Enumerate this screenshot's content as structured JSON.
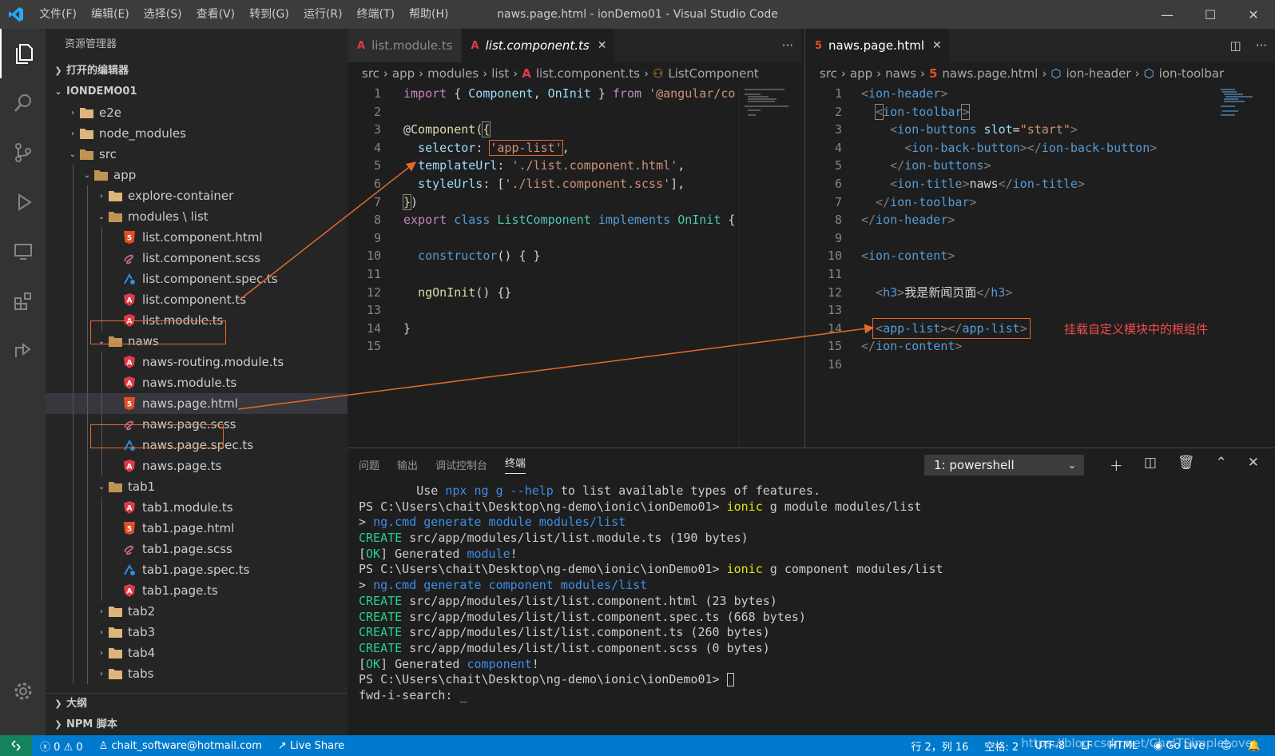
{
  "window": {
    "title": "naws.page.html - ionDemo01 - Visual Studio Code",
    "minimize": "—",
    "maximize": "☐",
    "close": "✕"
  },
  "menu": [
    "文件(F)",
    "编辑(E)",
    "选择(S)",
    "查看(V)",
    "转到(G)",
    "运行(R)",
    "终端(T)",
    "帮助(H)"
  ],
  "sidebar": {
    "title": "资源管理器",
    "open_editors": "打开的编辑器",
    "project": "IONDEMO01",
    "tree": [
      {
        "label": "e2e",
        "depth": 1,
        "type": "folder",
        "open": false
      },
      {
        "label": "node_modules",
        "depth": 1,
        "type": "folder",
        "open": false
      },
      {
        "label": "src",
        "depth": 1,
        "type": "folder",
        "open": true
      },
      {
        "label": "app",
        "depth": 2,
        "type": "folder",
        "open": true
      },
      {
        "label": "explore-container",
        "depth": 3,
        "type": "folder",
        "open": false
      },
      {
        "label": "modules \\ list",
        "depth": 3,
        "type": "folder",
        "open": true
      },
      {
        "label": "list.component.html",
        "depth": 4,
        "type": "html"
      },
      {
        "label": "list.component.scss",
        "depth": 4,
        "type": "scss"
      },
      {
        "label": "list.component.spec.ts",
        "depth": 4,
        "type": "spec"
      },
      {
        "label": "list.component.ts",
        "depth": 4,
        "type": "ts"
      },
      {
        "label": "list.module.ts",
        "depth": 4,
        "type": "ts"
      },
      {
        "label": "naws",
        "depth": 3,
        "type": "folder",
        "open": true
      },
      {
        "label": "naws-routing.module.ts",
        "depth": 4,
        "type": "ts"
      },
      {
        "label": "naws.module.ts",
        "depth": 4,
        "type": "ts"
      },
      {
        "label": "naws.page.html",
        "depth": 4,
        "type": "html",
        "selected": true
      },
      {
        "label": "naws.page.scss",
        "depth": 4,
        "type": "scss"
      },
      {
        "label": "naws.page.spec.ts",
        "depth": 4,
        "type": "spec"
      },
      {
        "label": "naws.page.ts",
        "depth": 4,
        "type": "ts"
      },
      {
        "label": "tab1",
        "depth": 3,
        "type": "folder",
        "open": true
      },
      {
        "label": "tab1.module.ts",
        "depth": 4,
        "type": "ts"
      },
      {
        "label": "tab1.page.html",
        "depth": 4,
        "type": "html"
      },
      {
        "label": "tab1.page.scss",
        "depth": 4,
        "type": "scss"
      },
      {
        "label": "tab1.page.spec.ts",
        "depth": 4,
        "type": "spec"
      },
      {
        "label": "tab1.page.ts",
        "depth": 4,
        "type": "ts"
      },
      {
        "label": "tab2",
        "depth": 3,
        "type": "folder",
        "open": false
      },
      {
        "label": "tab3",
        "depth": 3,
        "type": "folder",
        "open": false
      },
      {
        "label": "tab4",
        "depth": 3,
        "type": "folder",
        "open": false
      },
      {
        "label": "tabs",
        "depth": 3,
        "type": "folder",
        "open": false
      }
    ],
    "outline": "大纲",
    "npm": "NPM 脚本"
  },
  "editor_left": {
    "tabs": [
      {
        "label": "list.module.ts",
        "active": false
      },
      {
        "label": "list.component.ts",
        "active": true
      }
    ],
    "more": "···",
    "breadcrumb": [
      "src",
      "app",
      "modules",
      "list",
      "list.component.ts",
      "ListComponent"
    ],
    "line_numbers": [
      "1",
      "2",
      "3",
      "4",
      "5",
      "6",
      "7",
      "8",
      "9",
      "10",
      "11",
      "12",
      "13",
      "14",
      "15"
    ]
  },
  "editor_right": {
    "tab": {
      "label": "naws.page.html",
      "active": true
    },
    "more": "···",
    "breadcrumb": [
      "src",
      "app",
      "naws",
      "naws.page.html",
      "ion-header",
      "ion-toolbar"
    ],
    "line_numbers": [
      "1",
      "2",
      "3",
      "4",
      "5",
      "6",
      "7",
      "8",
      "9",
      "10",
      "11",
      "12",
      "13",
      "14",
      "15",
      "16"
    ],
    "heading_text": "我是新闻页面"
  },
  "annotation": {
    "label": "挂载自定义模块中的根组件",
    "color": "#e36a2a"
  },
  "panel": {
    "tabs": [
      "问题",
      "输出",
      "调试控制台",
      "终端"
    ],
    "active_tab": "终端",
    "terminal_select": "1: powershell",
    "lines": [
      "        Use npx ng g --help to list available types of features.",
      "PS C:\\Users\\chait\\Desktop\\ng-demo\\ionic\\ionDemo01> ionic g module modules/list",
      "> ng.cmd generate module modules/list",
      "CREATE src/app/modules/list/list.module.ts (190 bytes)",
      "[OK] Generated module!",
      "PS C:\\Users\\chait\\Desktop\\ng-demo\\ionic\\ionDemo01> ionic g component modules/list",
      "> ng.cmd generate component modules/list",
      "CREATE src/app/modules/list/list.component.html (23 bytes)",
      "CREATE src/app/modules/list/list.component.spec.ts (668 bytes)",
      "CREATE src/app/modules/list/list.component.ts (260 bytes)",
      "CREATE src/app/modules/list/list.component.scss (0 bytes)",
      "[OK] Generated component!",
      "PS C:\\Users\\chait\\Desktop\\ng-demo\\ionic\\ionDemo01> ",
      "fwd-i-search: _"
    ]
  },
  "status": {
    "errors": "0",
    "warnings": "0",
    "account": "chait_software@hotmail.com",
    "live_share": "Live Share",
    "position": "行 2，列 16",
    "spaces": "空格: 2",
    "encoding": "UTF-8",
    "eol": "LF",
    "language": "HTML",
    "go_live": "Go Live"
  },
  "watermark": "https://blog.csdn.net/ChaITSimpleLove",
  "colors": {
    "accent": "#007acc",
    "highlight": "#e36a2a",
    "angular": "#dd3b48",
    "html": "#e44d26"
  }
}
